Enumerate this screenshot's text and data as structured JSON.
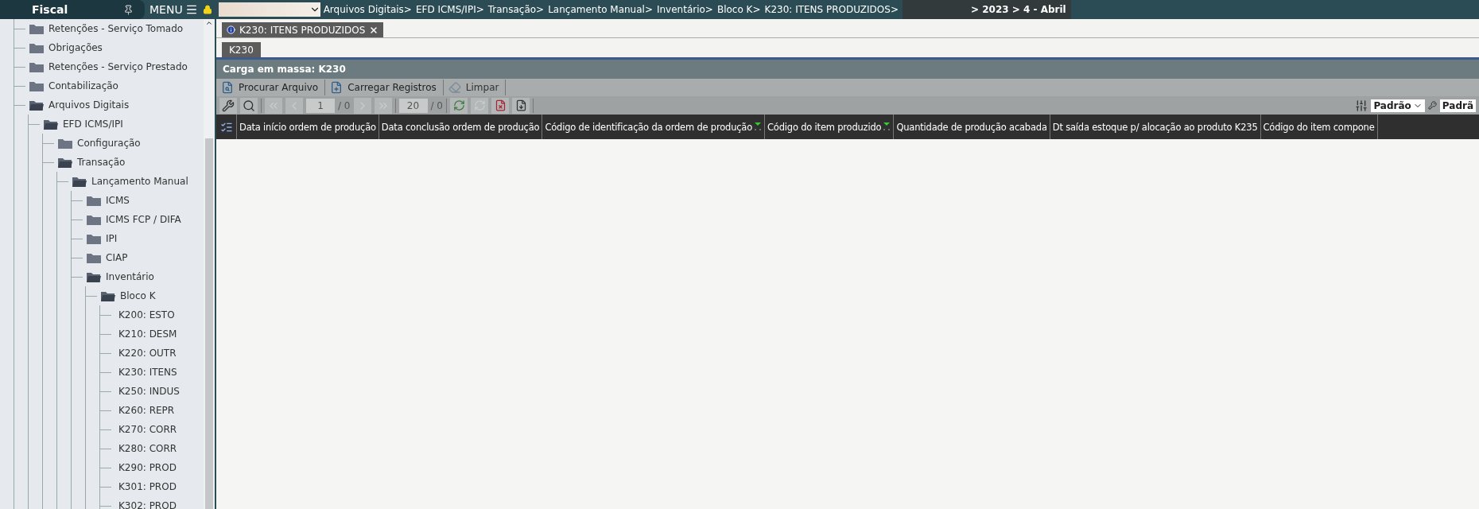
{
  "sidebar": {
    "title": "Fiscal",
    "menu_label": "MENU",
    "tree": [
      {
        "label": "Retenções - Serviço Tomado",
        "expanded": false
      },
      {
        "label": "Obrigações",
        "expanded": false
      },
      {
        "label": "Retenções - Serviço Prestado",
        "expanded": false
      },
      {
        "label": "Contabilização",
        "expanded": false
      },
      {
        "label": "Arquivos Digitais",
        "expanded": true,
        "children": [
          {
            "label": "EFD ICMS/IPI",
            "expanded": true,
            "children": [
              {
                "label": "Configuração",
                "expanded": false
              },
              {
                "label": "Transação",
                "expanded": true,
                "children": [
                  {
                    "label": "Lançamento Manual",
                    "expanded": true,
                    "children": [
                      {
                        "label": "ICMS",
                        "expanded": false
                      },
                      {
                        "label": "ICMS FCP / DIFA",
                        "expanded": false
                      },
                      {
                        "label": "IPI",
                        "expanded": false
                      },
                      {
                        "label": "CIAP",
                        "expanded": false
                      },
                      {
                        "label": "Inventário",
                        "expanded": true,
                        "children": [
                          {
                            "label": "Bloco K",
                            "expanded": true,
                            "children": [
                              {
                                "label": "K200: ESTO",
                                "kind": "leaf"
                              },
                              {
                                "label": "K210: DESM",
                                "kind": "leaf"
                              },
                              {
                                "label": "K220: OUTR",
                                "kind": "leaf"
                              },
                              {
                                "label": "K230: ITENS",
                                "kind": "leaf"
                              },
                              {
                                "label": "K250: INDUS",
                                "kind": "leaf"
                              },
                              {
                                "label": "K260: REPR",
                                "kind": "leaf"
                              },
                              {
                                "label": "K270: CORR",
                                "kind": "leaf"
                              },
                              {
                                "label": "K280: CORR",
                                "kind": "leaf"
                              },
                              {
                                "label": "K290: PROD",
                                "kind": "leaf"
                              },
                              {
                                "label": "K301: PROD",
                                "kind": "leaf"
                              },
                              {
                                "label": "K302: PROD",
                                "kind": "leaf"
                              }
                            ]
                          }
                        ]
                      }
                    ]
                  }
                ]
              }
            ]
          }
        ]
      }
    ]
  },
  "topbar": {
    "breadcrumb": [
      "Arquivos Digitais>",
      "EFD ICMS/IPI>",
      "Transação>",
      "Lançamento Manual>",
      "Inventário>",
      "Bloco K>",
      "K230: ITENS PRODUZIDOS>"
    ],
    "period": "> 2023 > 4 - Abril"
  },
  "tabs": [
    {
      "label": "K230: ITENS PRODUZIDOS",
      "selected": true
    }
  ],
  "subtabs": [
    {
      "label": "K230",
      "selected": true
    }
  ],
  "panel": {
    "title": "Carga em massa: K230",
    "actions": [
      {
        "label": "Procurar Arquivo",
        "kind": "search-file",
        "disabled": false
      },
      {
        "label": "Carregar Registros",
        "kind": "load",
        "disabled": false
      },
      {
        "label": "Limpar",
        "kind": "clear",
        "disabled": true
      }
    ],
    "pager": {
      "page": "1",
      "pages": "/ 0",
      "page_size": "20",
      "total": "/ 0"
    },
    "views": [
      "Padrão",
      "Padrã"
    ]
  },
  "table": {
    "columns": [
      {
        "label": "Data início ordem de produção",
        "filter_mark": false
      },
      {
        "label": "Data conclusão ordem de produção",
        "filter_mark": false
      },
      {
        "label": "Código de identificação da ordem de produção",
        "filter_mark": true
      },
      {
        "label": "Código do item produzido",
        "filter_mark": true
      },
      {
        "label": "Quantidade de produção acabada",
        "filter_mark": false
      },
      {
        "label": "Dt saída estoque p/ alocação ao produto K235",
        "filter_mark": false
      },
      {
        "label": "Código do item compone",
        "filter_mark": false
      }
    ]
  }
}
